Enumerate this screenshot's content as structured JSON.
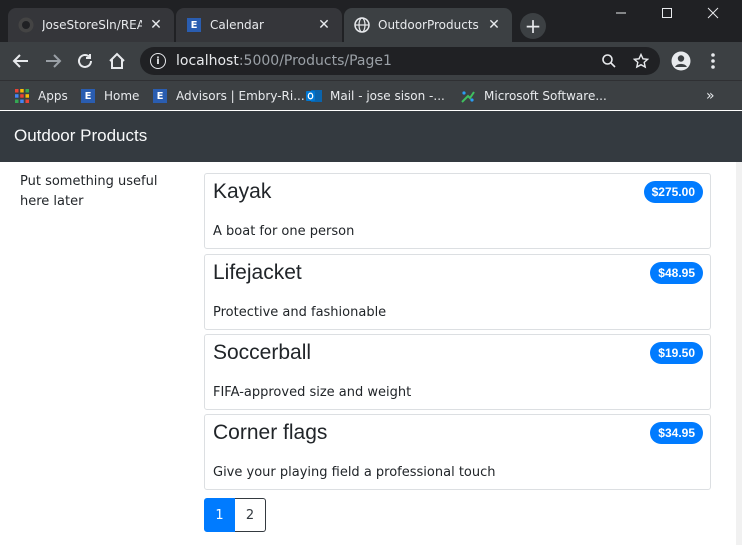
{
  "browser": {
    "tabs": [
      {
        "title": "JoseStoreSln/READM",
        "active": false
      },
      {
        "title": "Calendar",
        "active": false
      },
      {
        "title": "OutdoorProducts",
        "active": true
      }
    ],
    "url_host": "localhost",
    "url_path": ":5000/Products/Page1",
    "bookmarks": [
      {
        "label": "Apps"
      },
      {
        "label": "Home"
      },
      {
        "label": "Advisors | Embry-Ri..."
      },
      {
        "label": "Mail - jose sison -..."
      },
      {
        "label": "Microsoft Software..."
      }
    ],
    "overflow": "»"
  },
  "navbar": {
    "brand": "Outdoor Products"
  },
  "sidebar": {
    "text": "Put something useful here later"
  },
  "products": [
    {
      "name": "Kayak",
      "price": "$275.00",
      "description": "A boat for one person"
    },
    {
      "name": "Lifejacket",
      "price": "$48.95",
      "description": "Protective and fashionable"
    },
    {
      "name": "Soccerball",
      "price": "$19.50",
      "description": "FIFA-approved size and weight"
    },
    {
      "name": "Corner flags",
      "price": "$34.95",
      "description": "Give your playing field a professional touch"
    }
  ],
  "pagination": {
    "pages": [
      "1",
      "2"
    ],
    "current": "1"
  },
  "colors": {
    "navbar": "#343a40",
    "badge": "#007bff",
    "chrome": "#3c4043"
  }
}
